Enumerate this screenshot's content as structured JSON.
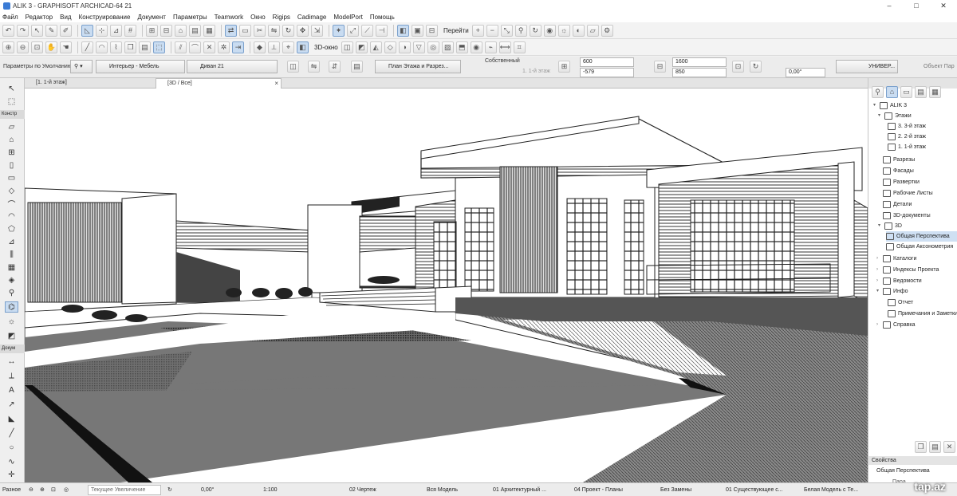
{
  "window": {
    "title": "ALIK 3 - GRAPHISOFT ARCHICAD-64 21",
    "buttons": {
      "minimize": "–",
      "maximize": "□",
      "close": "✕"
    }
  },
  "menu": [
    "Файл",
    "Редактор",
    "Вид",
    "Конструирование",
    "Документ",
    "Параметры",
    "Teamwork",
    "Окно",
    "Rigips",
    "Cadimage",
    "ModelPort",
    "Помощь"
  ],
  "toolbar": {
    "goto_label": "Перейти",
    "view_3d_label": "3D-окно"
  },
  "infobox": {
    "default_params": "Параметры по Умолчанию",
    "layer": "Интерьер - Мебель",
    "object_name": "Диван 21",
    "floorplan_section": "План Этажа и Разрез...",
    "own_label": "Собственный",
    "story_label": "1. 1-й этаж",
    "dim_a": "600",
    "dim_b": "-579",
    "dim_c": "1600",
    "dim_d": "850",
    "angle": "0,00°",
    "univ": "УНИВЕР...",
    "object_panel": "Объект Пар"
  },
  "tabs": [
    {
      "label": "[1. 1-й этаж]",
      "active": false
    },
    {
      "label": "[3D / Все]",
      "active": true,
      "close": "×"
    }
  ],
  "toolbox": {
    "section_construct": "Констр",
    "section_document": "Докум",
    "section_misc": "Разное"
  },
  "navigator": {
    "items": [
      {
        "label": "ALIK 3",
        "level": 0,
        "arrow": "▾"
      },
      {
        "label": "Этажи",
        "level": 1,
        "arrow": "▾"
      },
      {
        "label": "3. 3-й этаж",
        "level": 2,
        "arrow": ""
      },
      {
        "label": "2. 2-й этаж",
        "level": 2,
        "arrow": ""
      },
      {
        "label": "1. 1-й этаж",
        "level": 2,
        "arrow": ""
      },
      {
        "label": "Разрезы",
        "level": 1,
        "arrow": ""
      },
      {
        "label": "Фасады",
        "level": 1,
        "arrow": ""
      },
      {
        "label": "Развертки",
        "level": 1,
        "arrow": ""
      },
      {
        "label": "Рабочие Листы",
        "level": 1,
        "arrow": ""
      },
      {
        "label": "Детали",
        "level": 1,
        "arrow": ""
      },
      {
        "label": "3D-документы",
        "level": 1,
        "arrow": ""
      },
      {
        "label": "3D",
        "level": 1,
        "arrow": "▾"
      },
      {
        "label": "Общая Перспектива",
        "level": 2,
        "arrow": "",
        "selected": true
      },
      {
        "label": "Общая Аксонометрия",
        "level": 2,
        "arrow": ""
      },
      {
        "label": "Каталоги",
        "level": 0,
        "arrow": "›"
      },
      {
        "label": "Индексы Проекта",
        "level": 0,
        "arrow": "›"
      },
      {
        "label": "Ведомости",
        "level": 0,
        "arrow": "›"
      },
      {
        "label": "Инфо",
        "level": 0,
        "arrow": "▾"
      },
      {
        "label": "Отчет",
        "level": 1,
        "arrow": ""
      },
      {
        "label": "Примечания и Заметки",
        "level": 1,
        "arrow": ""
      },
      {
        "label": "Справка",
        "level": 0,
        "arrow": "›"
      }
    ],
    "properties_title": "Свойства",
    "properties_value": "Общая Перспектива",
    "properties_short": "Пара"
  },
  "status": {
    "zoom_placeholder": "Текущее Увеличение",
    "angle": "0,00°",
    "scale": "1:100",
    "pen_set": "02 Чертеж",
    "model_view": "Вся Модель",
    "layer_combo": "01 Архитектурный ...",
    "dim_std": "04 Проект - Планы",
    "override": "Без Замены",
    "renovation": "01 Существующее с...",
    "graphic": "Белая Модель с Те..."
  },
  "watermark": "tap.az"
}
